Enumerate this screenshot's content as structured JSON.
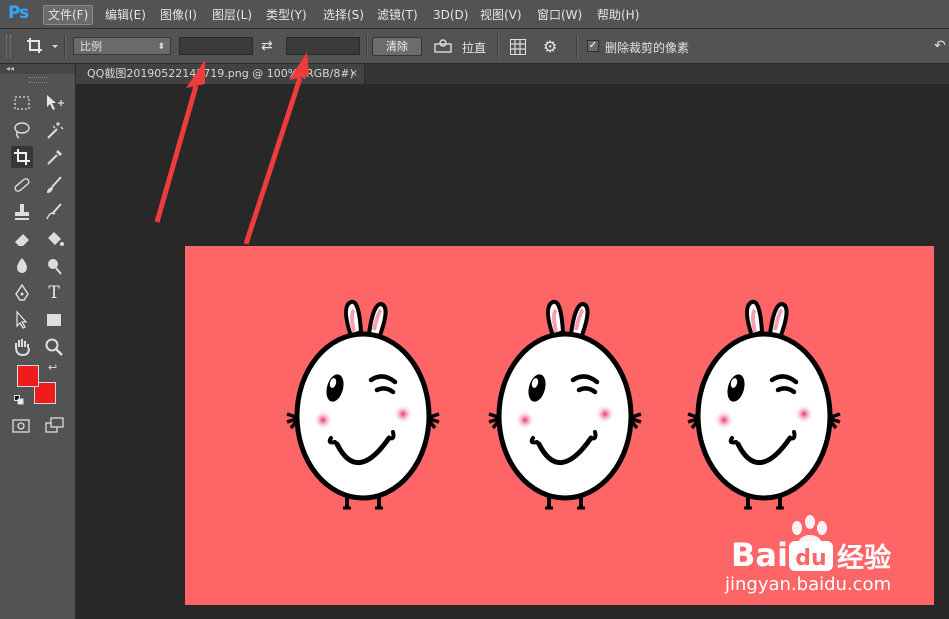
{
  "app": {
    "logo": "Ps"
  },
  "menubar": {
    "items": [
      "文件(F)",
      "编辑(E)",
      "图像(I)",
      "图层(L)",
      "类型(Y)",
      "选择(S)",
      "滤镜(T)",
      "3D(D)",
      "视图(V)",
      "窗口(W)",
      "帮助(H)"
    ]
  },
  "options": {
    "tool_icon": "crop-icon",
    "ratio_select": "比例",
    "width_value": "",
    "height_value": "",
    "swap_icon": "swap-icon",
    "clear_button": "清除",
    "straighten_label": "拉直",
    "overlay_icon": "grid-overlay-icon",
    "settings_icon": "gear-icon",
    "delete_cropped_checked": true,
    "delete_cropped_label": "删除裁剪的像素"
  },
  "document": {
    "tab_title": "QQ截图20190522142719.png @ 100% (RGB/8#)",
    "tab_close": "×"
  },
  "colors": {
    "foreground": "#ee1c1c",
    "background": "#ee1c1c",
    "canvas": "#fe6566",
    "annotation_arrow": "#ee3b3b"
  },
  "watermark": {
    "brand_left": "Bai",
    "brand_right": "经验",
    "url": "jingyan.baidu.com"
  }
}
